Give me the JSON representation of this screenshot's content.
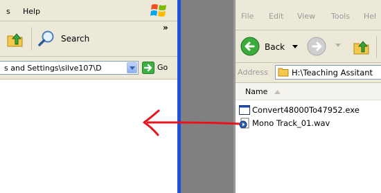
{
  "left_window": {
    "menu": [
      "s",
      "Help"
    ],
    "toolbar": {
      "chevron": "»",
      "search_label": "Search"
    },
    "address": {
      "value": "s and Settings\\silve107\\D",
      "go_label": "Go"
    }
  },
  "right_window": {
    "menu": [
      "File",
      "Edit",
      "View",
      "Tools",
      "Hel"
    ],
    "toolbar": {
      "back_label": "Back"
    },
    "address": {
      "label": "Address",
      "value": "H:\\Teaching Assitant"
    },
    "column_header": "Name",
    "files": [
      {
        "name": "Convert48000To47952.exe",
        "icon": "exe-icon"
      },
      {
        "name": "Mono Track_01.wav",
        "icon": "wav-audio-icon"
      }
    ]
  },
  "annotation": {
    "color": "#e8141c",
    "direction": "left"
  }
}
